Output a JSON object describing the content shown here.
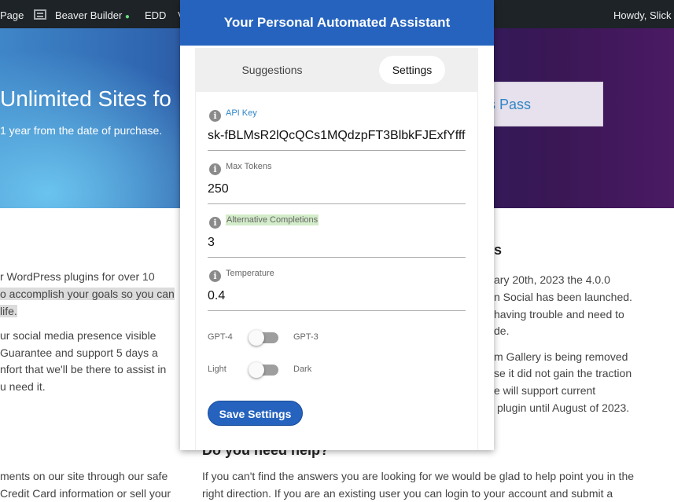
{
  "admin_bar": {
    "page_label": "Page",
    "beaver_builder": "Beaver Builder",
    "edd": "EDD",
    "v": "V",
    "howdy": "Howdy, Slick"
  },
  "hero": {
    "title": "Unlimited Sites fo",
    "subtitle": "1 year from the date of purchase.",
    "pass_button": "ss Pass"
  },
  "content": {
    "left": [
      "r WordPress plugins for over 10",
      "o accomplish your goals so you can",
      "life.",
      "ur social media presence visible",
      "Guarantee and support 5 days a",
      "nfort that we'll be there to assist in",
      "u need it.",
      "ments on our site through our safe",
      "Credit Card information or sell your"
    ],
    "right_heading": "s",
    "right": [
      "ary 20th, 2023 the 4.0.0",
      "n Social has been launched.",
      "having trouble and need to",
      "de.",
      "m Gallery is being removed",
      "se it did not gain the traction",
      "e will support current",
      "plugin until August of 2023."
    ],
    "help_heading": "Do you need help?",
    "help_text": [
      "If you can't find the answers you are looking for we would be glad to help point you in the",
      "right direction. If you are an existing user you can login to your account and submit a"
    ]
  },
  "popup": {
    "title": "Your Personal Automated Assistant",
    "tabs": {
      "suggestions": "Suggestions",
      "settings": "Settings"
    },
    "fields": {
      "api_key": {
        "label": "API Key",
        "value": "sk-fBLMsR2lQcQCs1MQdzpFT3BlbkFJExfYfff"
      },
      "max_tokens": {
        "label": "Max Tokens",
        "value": "250"
      },
      "alt_completions": {
        "label": "Alternative Completions",
        "value": "3"
      },
      "temperature": {
        "label": "Temperature",
        "value": "0.4"
      }
    },
    "toggles": {
      "model": {
        "left": "GPT-4",
        "right": "GPT-3"
      },
      "theme": {
        "left": "Light",
        "right": "Dark"
      }
    },
    "save_label": "Save Settings",
    "info_glyph": "i"
  },
  "colors": {
    "primary": "#2563be",
    "admin_bar": "#1d2327",
    "highlight_green": "#d3ecc9"
  }
}
